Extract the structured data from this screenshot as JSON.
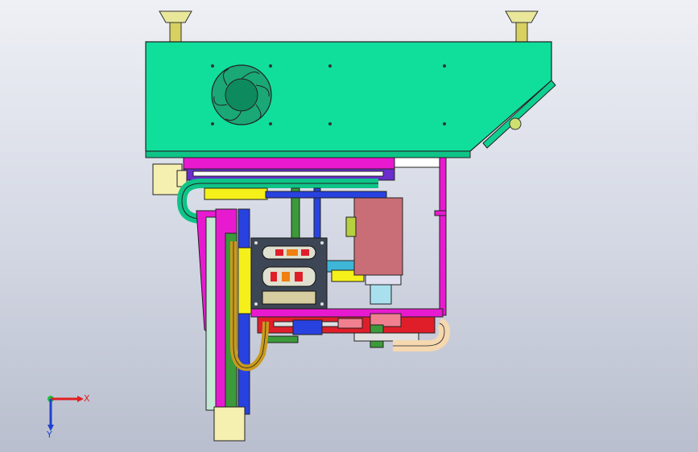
{
  "viewport": {
    "background_top": "#eef0f5",
    "background_bottom": "#b9bece"
  },
  "model": {
    "colors": {
      "housing": "#10df9c",
      "fan": "#1aa877",
      "magenta": "#e81ad0",
      "purple": "#6a2ccc",
      "yellow": "#f5f01a",
      "olive": "#c99a1a",
      "blue": "#2842e0",
      "pink": "#c96e76",
      "red": "#e01e2a",
      "dark_panel": "#3d4654",
      "cream": "#f5efb0"
    }
  },
  "triad": {
    "x_label": "X",
    "y_label": "Y",
    "x_color": "#e02020",
    "y_color": "#2040d0",
    "origin_color": "#20c040"
  }
}
